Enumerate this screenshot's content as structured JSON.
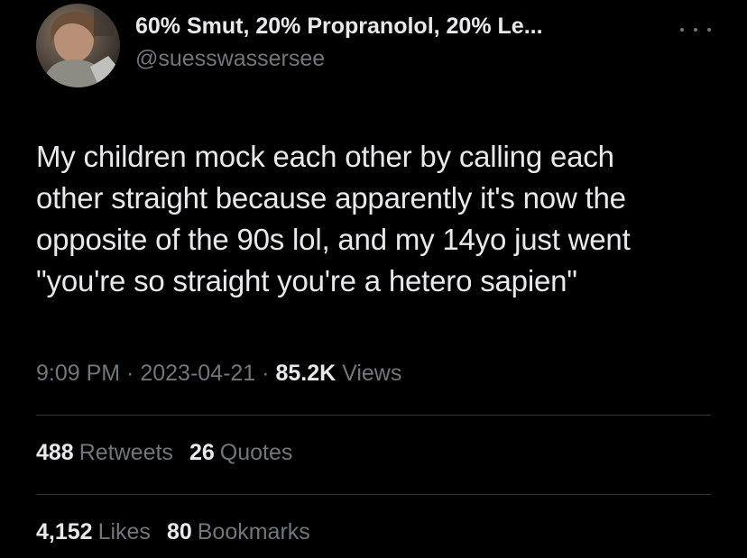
{
  "author": {
    "display_name": "60% Smut, 20% Propranolol, 20% Le...",
    "handle": "@suesswassersee"
  },
  "tweet": {
    "text": "My children mock each other by calling each\nother straight because apparently it's now the\nopposite of the 90s lol, and my 14yo just went\n\"you're so straight you're a hetero sapien\""
  },
  "meta": {
    "time": "9:09 PM",
    "sep1": " · ",
    "date": "2023-04-21",
    "sep2": " · ",
    "views_count": "85.2K",
    "views_label": " Views"
  },
  "stats": {
    "retweets": {
      "count": "488",
      "label": "Retweets"
    },
    "quotes": {
      "count": "26",
      "label": "Quotes"
    },
    "likes": {
      "count": "4,152",
      "label": "Likes"
    },
    "bookmarks": {
      "count": "80",
      "label": "Bookmarks"
    }
  },
  "icons": {
    "more": "more-options-icon",
    "avatar": "avatar"
  },
  "colors": {
    "background": "#000000",
    "primary_text": "#e7e9ea",
    "secondary_text": "#71767b",
    "divider": "#2f3336"
  }
}
